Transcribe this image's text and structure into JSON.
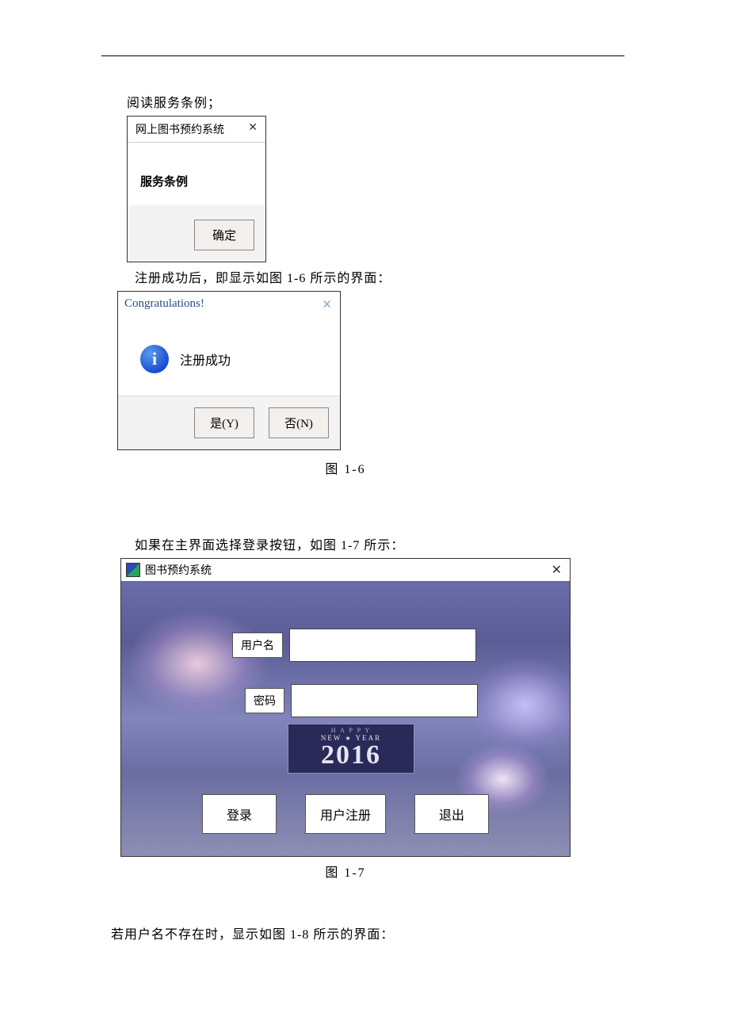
{
  "text": {
    "line1": "阅读服务条例；",
    "line2": "注册成功后，即显示如图 1-6 所示的界面：",
    "line3": "如果在主界面选择登录按钮，如图 1-7 所示：",
    "line4": "若用户名不存在时，显示如图 1-8 所示的界面："
  },
  "dialog1": {
    "title": "网上图书预约系统",
    "body": "服务条例",
    "ok": "确定"
  },
  "dialog2": {
    "title": "Congratulations!",
    "body": "注册成功",
    "yes": "是(Y)",
    "no": "否(N)"
  },
  "caption1": "图 1-6",
  "login": {
    "title": "图书预约系统",
    "username_label": "用户名",
    "password_label": "密码",
    "year_top": "H  A  P  P  Y",
    "year_mid": "NEW ★ YEAR",
    "year": "2016",
    "btn_login": "登录",
    "btn_register": "用户注册",
    "btn_exit": "退出"
  },
  "caption2": "图 1-7"
}
